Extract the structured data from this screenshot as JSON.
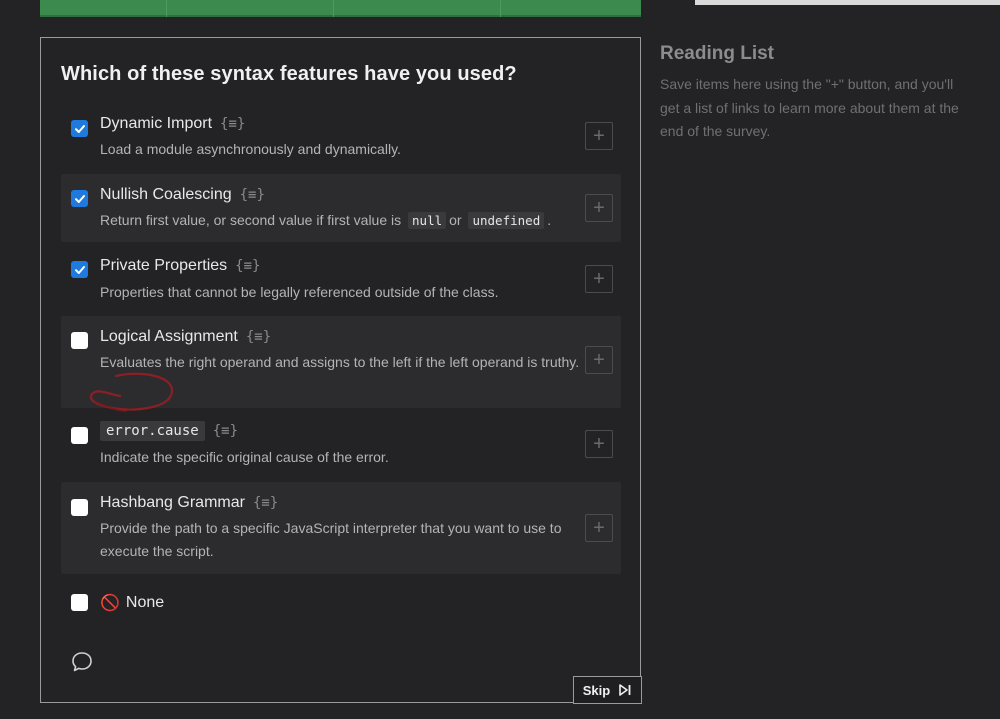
{
  "survey": {
    "question": "Which of these syntax features have you used?",
    "options": [
      {
        "title": "Dynamic Import",
        "description": "Load a module asynchronously and dynamically.",
        "checked": true
      },
      {
        "title": "Nullish Coalescing",
        "description_before": "Return first value, or second value if first value is",
        "code1": "null",
        "description_mid": "or",
        "code2": "undefined",
        "description_after": ".",
        "checked": true
      },
      {
        "title": "Private Properties",
        "description": "Properties that cannot be legally referenced outside of the class.",
        "checked": true
      },
      {
        "title": "Logical Assignment",
        "description": "Evaluates the right operand and assigns to the left if the left operand is truthy.",
        "checked": false
      },
      {
        "title": "error.cause",
        "description": "Indicate the specific original cause of the error.",
        "checked": false
      },
      {
        "title": "Hashbang Grammar",
        "description": "Provide the path to a specific JavaScript interpreter that you want to use to execute the script.",
        "checked": false
      }
    ],
    "none_label": "None",
    "info_icon_text": "{≡}",
    "add_symbol": "+",
    "skip_label": "Skip"
  },
  "reading_list": {
    "title": "Reading List",
    "text": "Save items here using the \"+\" button, and you'll get a list of links to learn more about them at the end of the survey."
  },
  "icons": {
    "check": "check-icon",
    "info": "info-braces-icon",
    "add": "plus-icon",
    "none": "no-entry-icon",
    "comment": "speech-bubble-icon",
    "skip": "skip-forward-icon"
  },
  "colors": {
    "background": "#232325",
    "checkbox_checked": "#1f7ae0",
    "progress_bar": "#3c8a4e"
  }
}
